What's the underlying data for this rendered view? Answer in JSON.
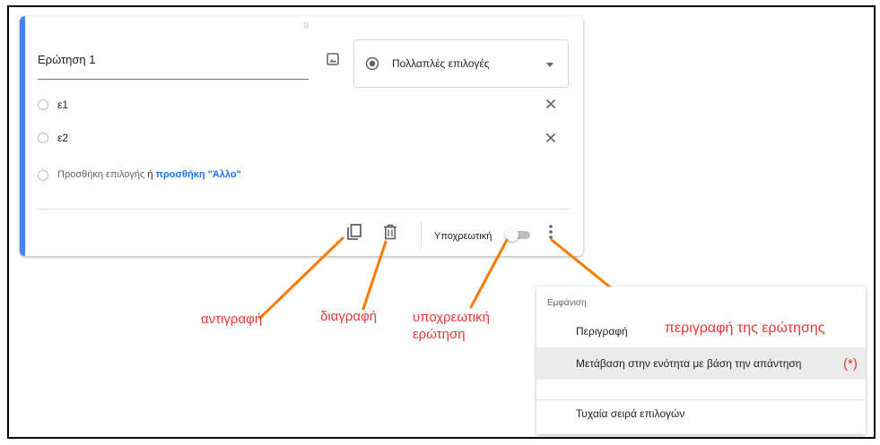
{
  "question": {
    "drag_handle": "⠿",
    "title": "Ερώτηση 1",
    "type_label": "Πολλαπλές επιλογές",
    "options": [
      {
        "label": "ε1"
      },
      {
        "label": "ε2"
      }
    ],
    "add_option": {
      "text": "Προσθήκη επιλογής",
      "or": "ή",
      "link": "προσθήκη \"Άλλο\""
    },
    "required_label": "Υποχρεωτική",
    "required_on": false
  },
  "annotations": {
    "copy": "αντιγραφή",
    "delete": "διαγραφή",
    "required_line1": "υποχρεωτική",
    "required_line2": "ερώτηση",
    "description": "περιγραφή της ερώτησης",
    "asterisk": "(*)"
  },
  "menu": {
    "header": "Εμφάνιση",
    "items": [
      {
        "label": "Περιγραφή"
      },
      {
        "label": "Μετάβαση στην ενότητα με βάση την απάντηση"
      },
      {
        "label": "Τυχαία σειρά επιλογών"
      }
    ]
  },
  "colors": {
    "accent": "#4285f4",
    "link": "#1a73e8",
    "annotation": "#e53935",
    "arrow": "#f57c00"
  }
}
